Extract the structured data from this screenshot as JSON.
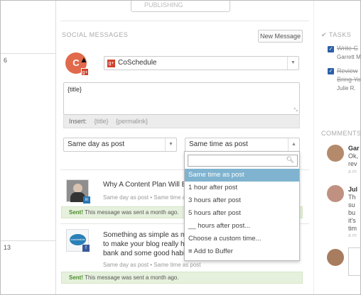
{
  "calendar": {
    "week_numbers": [
      "6",
      "13"
    ]
  },
  "header": {
    "publishing_label": "PUBLISHING"
  },
  "social": {
    "section_title": "SOCIAL MESSAGES",
    "new_message_label": "New Message",
    "account_name": "CoSchedule",
    "account_avatar_text": "C",
    "message_text": "{title}",
    "insert_label": "Insert:",
    "insert_tokens": [
      "{title}",
      "{permalink}"
    ],
    "day_select": "Same day as post",
    "time_select": "Same time as post"
  },
  "dropdown": {
    "search_placeholder": "",
    "options": [
      "Same time as post",
      "1 hour after post",
      "3 hours after post",
      "5 hours after post",
      "__ hours after post...",
      "Choose a custom time...",
      "Add to Buffer"
    ],
    "selected_index": 0
  },
  "messages": [
    {
      "title": "Why A Content Plan Will Bring",
      "meta": "Same day as post • Same time as post",
      "sent_label": "Sent!",
      "sent_text": "This message was sent a month ago.",
      "network": "linkedin"
    },
    {
      "title_lines": [
        "Something as simple as making",
        "to make your blog really happy!",
        "bank and some good habits."
      ],
      "meta": "Same day as post • Same time as post",
      "sent_label": "Sent!",
      "sent_text": "This message was sent a month ago.",
      "thumb_text": "coschedule",
      "network": "facebook"
    }
  ],
  "tasks": {
    "title": "TASKS",
    "items": [
      {
        "text": "Write C",
        "assignee": "Garrett M"
      },
      {
        "text": "Review",
        "text2": "Bring Yo",
        "assignee": "Julie R."
      }
    ]
  },
  "comments": {
    "title": "COMMENTS",
    "items": [
      {
        "name": "Gar",
        "lines": [
          "Ok,",
          "rev"
        ],
        "time": "a m"
      },
      {
        "name": "Jul",
        "lines": [
          "Th",
          "su",
          "bu",
          "it's",
          "tim"
        ],
        "time": "a m"
      },
      {
        "name": "",
        "lines": [],
        "time": ""
      }
    ]
  },
  "colors": {
    "accent": "#7fb3cf",
    "sent_bg": "#e6f1dd",
    "sent_text": "#4b8a2c",
    "gplus": "#d0422d",
    "brand_avatar": "#e06a4b",
    "checkbox": "#2c5fa8"
  }
}
